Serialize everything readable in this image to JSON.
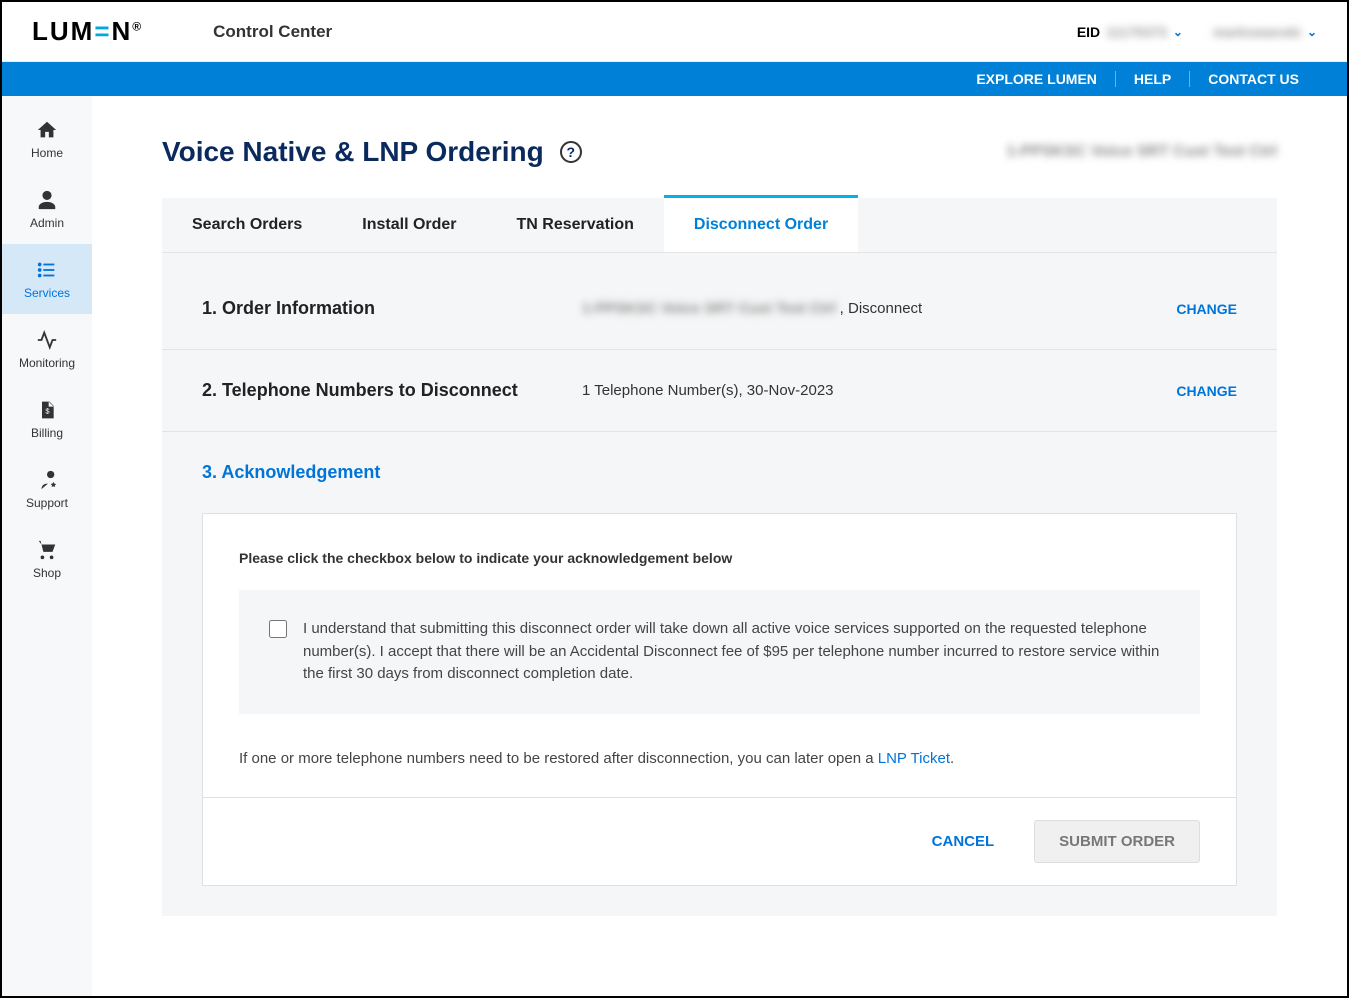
{
  "header": {
    "logo_text": "LUM=N",
    "logo_reg": "®",
    "title": "Control Center",
    "eid_label": "EID",
    "eid_value": "11175373",
    "username": "markswanski"
  },
  "bluebar": {
    "explore": "EXPLORE LUMEN",
    "help": "HELP",
    "contact": "CONTACT US"
  },
  "sidebar": {
    "items": [
      {
        "label": "Home"
      },
      {
        "label": "Admin"
      },
      {
        "label": "Services"
      },
      {
        "label": "Monitoring"
      },
      {
        "label": "Billing"
      },
      {
        "label": "Support"
      },
      {
        "label": "Shop"
      }
    ]
  },
  "page": {
    "title": "Voice Native & LNP Ordering",
    "subtitle_blur": "1-PPSKSC Voice SRT Cust Test Ctrl"
  },
  "tabs": [
    {
      "label": "Search Orders"
    },
    {
      "label": "Install Order"
    },
    {
      "label": "TN Reservation"
    },
    {
      "label": "Disconnect Order"
    }
  ],
  "steps": {
    "s1": {
      "title": "1. Order Information",
      "value_blur": "1-PPSKSC Voice SRT Cust Test Ctrl",
      "value_tail": " , Disconnect",
      "change": "CHANGE"
    },
    "s2": {
      "title": "2. Telephone Numbers to Disconnect",
      "value": "1 Telephone Number(s), 30-Nov-2023",
      "change": "CHANGE"
    },
    "s3": {
      "title": "3. Acknowledgement"
    }
  },
  "ack": {
    "prompt": "Please click the checkbox below to indicate your acknowledgement below",
    "text": "I understand that submitting this disconnect order will take down all active voice services supported on the requested telephone number(s). I accept that there will be an Accidental Disconnect fee of $95 per telephone number incurred to restore service within the first 30 days from disconnect completion date.",
    "restore_pre": "If one or more telephone numbers need to be restored after disconnection, you can later open a ",
    "restore_link": "LNP Ticket",
    "restore_post": "."
  },
  "actions": {
    "cancel": "CANCEL",
    "submit": "SUBMIT ORDER"
  }
}
